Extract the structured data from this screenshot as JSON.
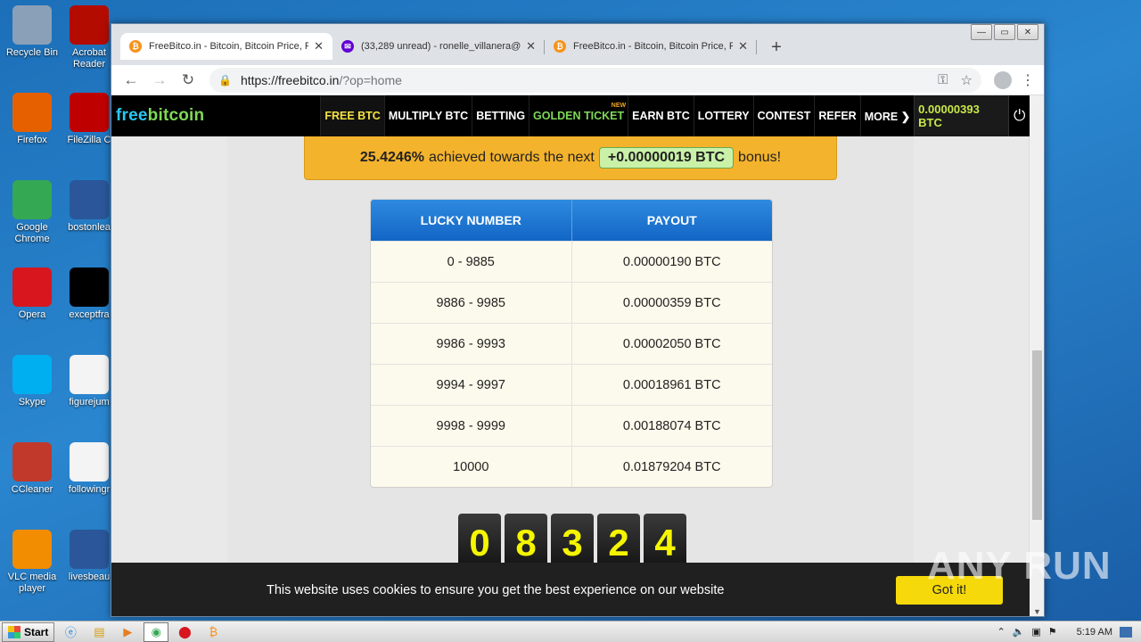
{
  "desktop": {
    "icons": [
      {
        "label": "Recycle Bin",
        "icon": "recycle-bin-icon",
        "color": "#8aa0b8"
      },
      {
        "label": "Firefox",
        "icon": "firefox-icon",
        "color": "#e66000"
      },
      {
        "label": "Google Chrome",
        "icon": "chrome-icon",
        "color": "#34a853"
      },
      {
        "label": "Opera",
        "icon": "opera-icon",
        "color": "#d7161e"
      },
      {
        "label": "Skype",
        "icon": "skype-icon",
        "color": "#00aff0"
      },
      {
        "label": "CCleaner",
        "icon": "ccleaner-icon",
        "color": "#c0392b"
      },
      {
        "label": "VLC media player",
        "icon": "vlc-icon",
        "color": "#f28c00"
      },
      {
        "label": "Acrobat Reader",
        "icon": "acrobat-icon",
        "color": "#b30b00"
      },
      {
        "label": "FileZilla C",
        "icon": "filezilla-icon",
        "color": "#bf0000"
      },
      {
        "label": "bostonlea",
        "icon": "word-doc-icon",
        "color": "#2b579a"
      },
      {
        "label": "exceptfra",
        "icon": "black-file-icon",
        "color": "#000000"
      },
      {
        "label": "figurejum",
        "icon": "blank-file-icon",
        "color": "#f4f4f4"
      },
      {
        "label": "followingr",
        "icon": "blank-file-icon",
        "color": "#f4f4f4"
      },
      {
        "label": "livesbeau",
        "icon": "word-doc-icon",
        "color": "#2b579a"
      }
    ]
  },
  "browser": {
    "tabs": [
      {
        "title": "FreeBitco.in - Bitcoin, Bitcoin Price, F",
        "favicon_color": "#f7931a",
        "favicon_glyph": "₿"
      },
      {
        "title": "(33,289 unread) - ronelle_villanera@",
        "favicon_color": "#6001d2",
        "favicon_glyph": "✉"
      },
      {
        "title": "FreeBitco.in - Bitcoin, Bitcoin Price, F",
        "favicon_color": "#f7931a",
        "favicon_glyph": "₿"
      }
    ],
    "new_tab": "+",
    "url_host": "https://freebitco.in",
    "url_path": "/?op=home"
  },
  "site": {
    "brand_a": "free",
    "brand_b": "bitcoin",
    "nav": [
      {
        "label": "FREE BTC",
        "state": "active"
      },
      {
        "label": "MULTIPLY BTC",
        "state": ""
      },
      {
        "label": "BETTING",
        "state": ""
      },
      {
        "label": "GOLDEN TICKET",
        "state": "golden",
        "sup": "NEW"
      },
      {
        "label": "EARN BTC",
        "state": ""
      },
      {
        "label": "LOTTERY",
        "state": ""
      },
      {
        "label": "CONTEST",
        "state": ""
      },
      {
        "label": "REFER",
        "state": ""
      },
      {
        "label": "MORE ❯",
        "state": ""
      }
    ],
    "balance": "0.00000393 BTC",
    "bonus": {
      "percent": "25.4246%",
      "text_a": "achieved towards the next",
      "amount": "+0.00000019 BTC",
      "text_b": "bonus!"
    },
    "payout_table": {
      "headers": [
        "LUCKY NUMBER",
        "PAYOUT"
      ],
      "rows": [
        [
          "0 - 9885",
          "0.00000190 BTC"
        ],
        [
          "9886 - 9985",
          "0.00000359 BTC"
        ],
        [
          "9986 - 9993",
          "0.00002050 BTC"
        ],
        [
          "9994 - 9997",
          "0.00018961 BTC"
        ],
        [
          "9998 - 9999",
          "0.00188074 BTC"
        ],
        [
          "10000",
          "0.01879204 BTC"
        ]
      ]
    },
    "digits": [
      "0",
      "8",
      "3",
      "2",
      "4"
    ],
    "cookie": {
      "message": "This website uses cookies to ensure you get the best experience on our website",
      "button": "Got it!"
    }
  },
  "watermark": "ANY RUN",
  "taskbar": {
    "start": "Start",
    "clock": "5:19 AM"
  }
}
